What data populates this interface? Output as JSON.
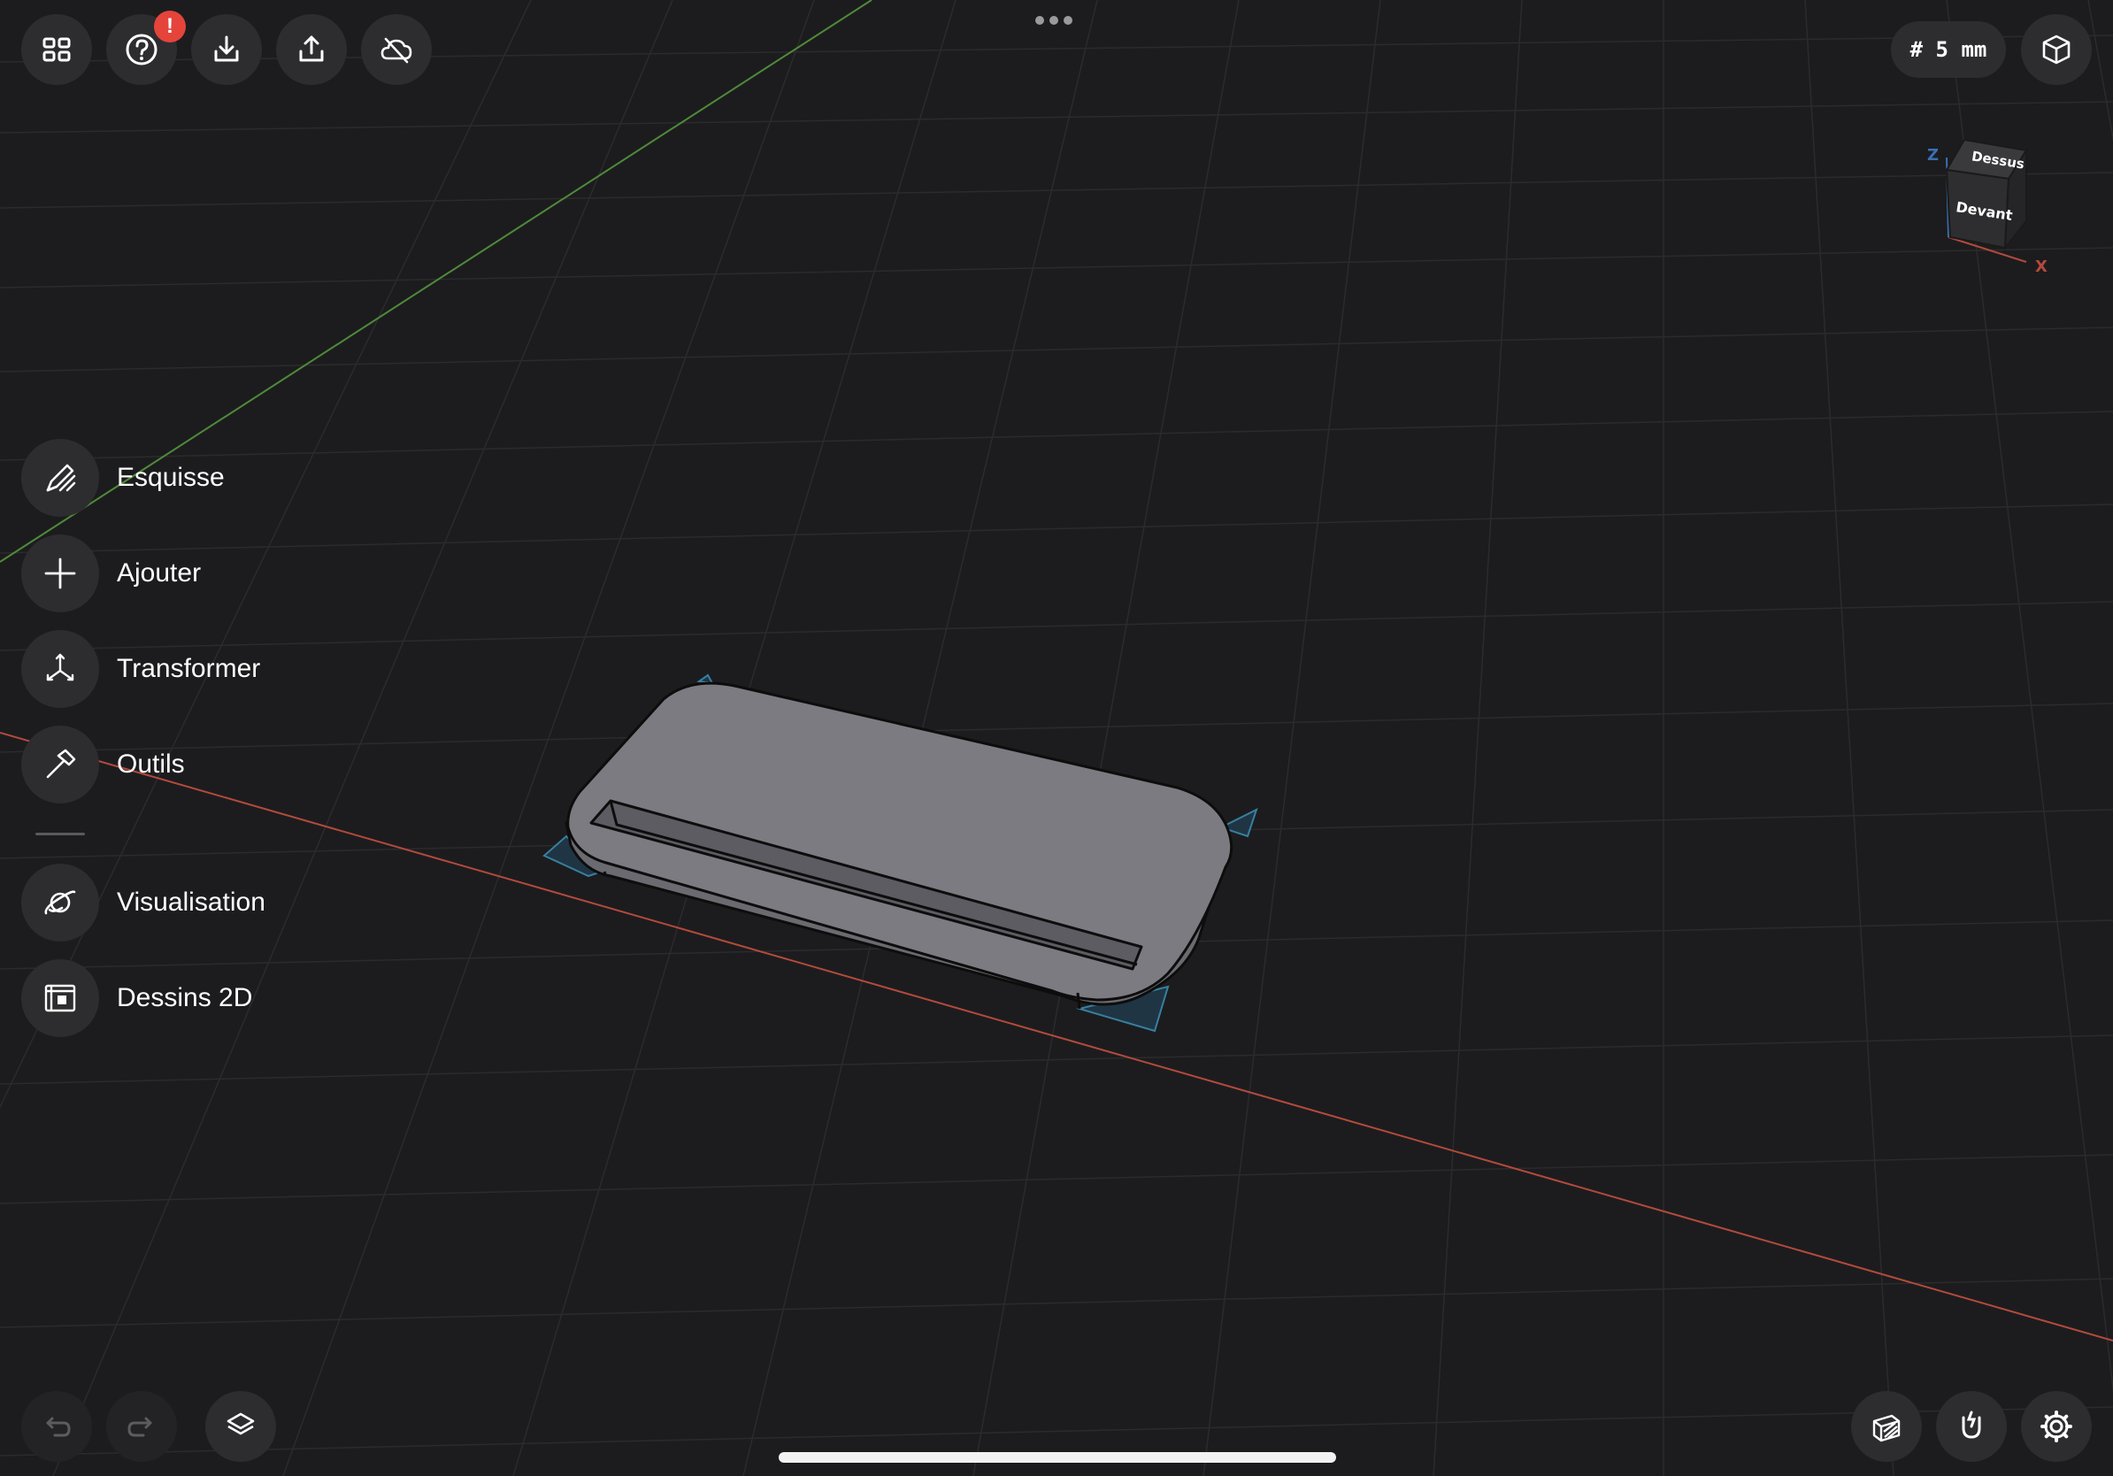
{
  "toolbar": {
    "notification_badge": "!",
    "grid_size_label": "# 5 mm"
  },
  "icons": {
    "apps": "grid-icon",
    "help": "question-icon",
    "import": "import-icon",
    "export": "share-icon",
    "cloud": "cloud-off-icon",
    "view": "cube-view-icon",
    "undo": "undo-icon",
    "redo": "redo-icon",
    "layers": "layers-icon",
    "section": "section-plane-icon",
    "snap": "magnet-icon",
    "settings": "gear-icon"
  },
  "view_cube": {
    "top": "Dessus",
    "front": "Devant",
    "axis_z": "Z",
    "axis_x": "X"
  },
  "side_menu": {
    "sketch": "Esquisse",
    "add": "Ajouter",
    "transform": "Transformer",
    "tools": "Outils",
    "visualization": "Visualisation",
    "drawings": "Dessins 2D"
  },
  "colors": {
    "background": "#1c1c1e",
    "button": "#2d2d2f",
    "x_axis": "#b34a3c",
    "y_axis": "#4f8a3a",
    "model": "#77777d",
    "selection": "#3a8bb0",
    "badge": "#e5443b"
  }
}
